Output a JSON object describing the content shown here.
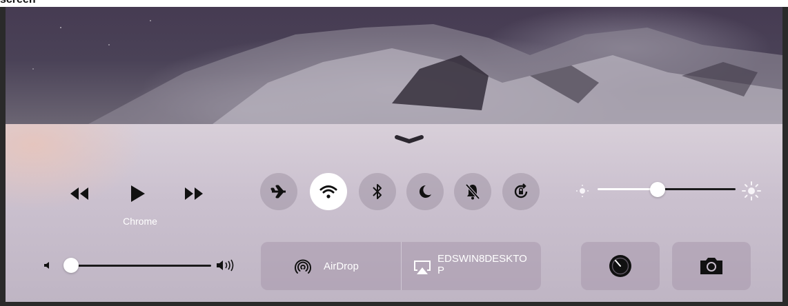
{
  "caption": {
    "text": "screen"
  },
  "control_center": {
    "media": {
      "now_playing": "Chrome",
      "rewind_icon": "rewind-icon",
      "play_icon": "play-icon",
      "forward_icon": "fast-forward-icon"
    },
    "toggles": [
      {
        "name": "airplane-mode",
        "icon": "airplane-icon",
        "on": false
      },
      {
        "name": "wifi",
        "icon": "wifi-icon",
        "on": true
      },
      {
        "name": "bluetooth",
        "icon": "bluetooth-icon",
        "on": false
      },
      {
        "name": "do-not-disturb",
        "icon": "moon-icon",
        "on": false
      },
      {
        "name": "mute",
        "icon": "bell-slash-icon",
        "on": false
      },
      {
        "name": "rotation-lock",
        "icon": "rotation-lock-icon",
        "on": false
      }
    ],
    "brightness": {
      "level": 0.55
    },
    "volume": {
      "level": 0.0
    },
    "airdrop": {
      "label": "AirDrop",
      "icon": "airdrop-icon"
    },
    "airplay": {
      "label_line1": "EDSWIN8DESKTO",
      "label_line2": "P",
      "icon": "airplay-icon"
    },
    "shortcuts": [
      {
        "name": "timer",
        "icon": "timer-icon"
      },
      {
        "name": "camera",
        "icon": "camera-icon"
      }
    ]
  },
  "colors": {
    "toggle_on": "#ffffff",
    "toggle_off": "#9a8fa1",
    "glyph": "#111111"
  }
}
